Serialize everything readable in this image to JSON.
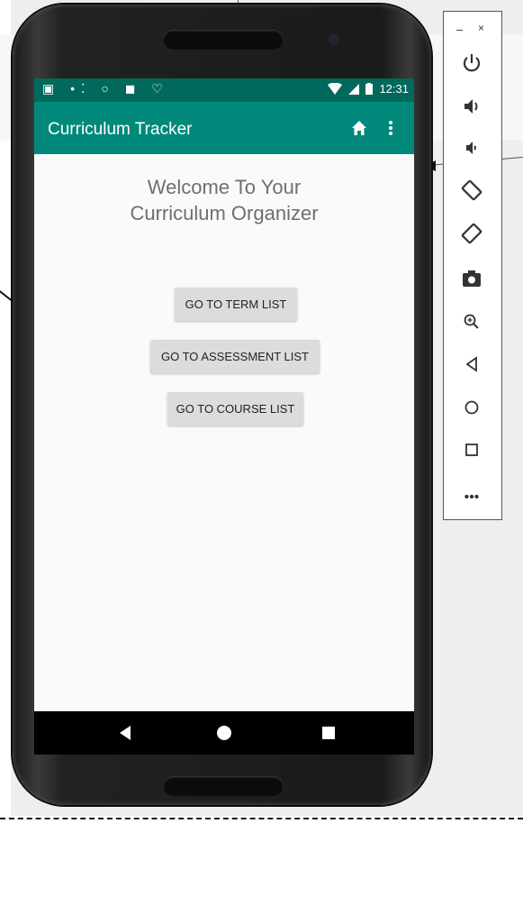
{
  "app": {
    "title": "Curriculum Tracker",
    "status_time": "12:31",
    "status_left_icons": "▣ •⁚ ○ ◼ ♡",
    "welcome_line1": "Welcome To Your",
    "welcome_line2": "Curriculum Organizer"
  },
  "buttons": {
    "term_list": "GO TO TERM LIST",
    "assessment_list": "GO TO ASSESSMENT LIST",
    "course_list": "GO TO COURSE LIST"
  },
  "toolbar": {
    "minimize": "–",
    "close": "×",
    "items": [
      "power-icon",
      "volume-up-icon",
      "volume-down-icon",
      "rotate-left-icon",
      "rotate-right-icon",
      "camera-icon",
      "zoom-icon",
      "back-icon",
      "home-icon",
      "overview-icon"
    ],
    "more": "•••"
  },
  "colors": {
    "app_bar": "#00897b",
    "status_bar": "#00695c",
    "button": "#dcdcdc",
    "screen_bg": "#fafafa"
  }
}
